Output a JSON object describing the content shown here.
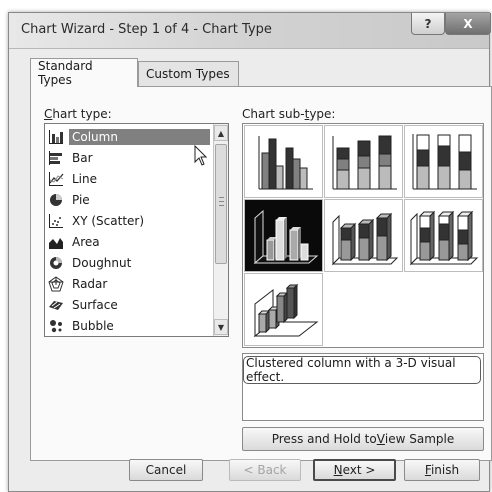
{
  "window": {
    "title": "Chart Wizard - Step 1 of 4 - Chart Type",
    "help_label": "?",
    "close_label": "X"
  },
  "tabs": [
    {
      "label": "Standard Types",
      "active": true
    },
    {
      "label": "Custom Types",
      "active": false
    }
  ],
  "chart_type": {
    "label_underline": "C",
    "label_rest": "hart type:",
    "selected": "Column",
    "items": [
      {
        "label": "Column",
        "icon": "column-chart-icon"
      },
      {
        "label": "Bar",
        "icon": "bar-chart-icon"
      },
      {
        "label": "Line",
        "icon": "line-chart-icon"
      },
      {
        "label": "Pie",
        "icon": "pie-chart-icon"
      },
      {
        "label": "XY (Scatter)",
        "icon": "scatter-chart-icon"
      },
      {
        "label": "Area",
        "icon": "area-chart-icon"
      },
      {
        "label": "Doughnut",
        "icon": "doughnut-chart-icon"
      },
      {
        "label": "Radar",
        "icon": "radar-chart-icon"
      },
      {
        "label": "Surface",
        "icon": "surface-chart-icon"
      },
      {
        "label": "Bubble",
        "icon": "bubble-chart-icon"
      }
    ]
  },
  "subtype": {
    "label_before": "Chart sub-",
    "label_underline": "t",
    "label_after": "ype:",
    "selected_index": 3,
    "tiles": [
      {
        "name": "clustered-column",
        "icon": "clustered-column-icon"
      },
      {
        "name": "stacked-column",
        "icon": "stacked-column-icon"
      },
      {
        "name": "100-percent-stacked-column",
        "icon": "percent-stacked-column-icon"
      },
      {
        "name": "3d-clustered-column",
        "icon": "3d-clustered-column-icon"
      },
      {
        "name": "3d-stacked-column",
        "icon": "3d-stacked-column-icon"
      },
      {
        "name": "3d-100-percent-stacked-column",
        "icon": "3d-percent-stacked-column-icon"
      },
      {
        "name": "3d-column",
        "icon": "3d-column-icon"
      }
    ]
  },
  "description": "Clustered column with a 3-D visual effect.",
  "buttons": {
    "press_hold_before": "Press and Hold to ",
    "press_hold_underline": "V",
    "press_hold_after": "iew Sample",
    "cancel": "Cancel",
    "back": "< Back",
    "next_underline": "N",
    "next_rest": "ext >",
    "finish_underline": "F",
    "finish_rest": "inish"
  },
  "colors": {
    "selection": "#808080",
    "dialog_bg": "#ececec",
    "panel_bg": "#fafafa"
  }
}
